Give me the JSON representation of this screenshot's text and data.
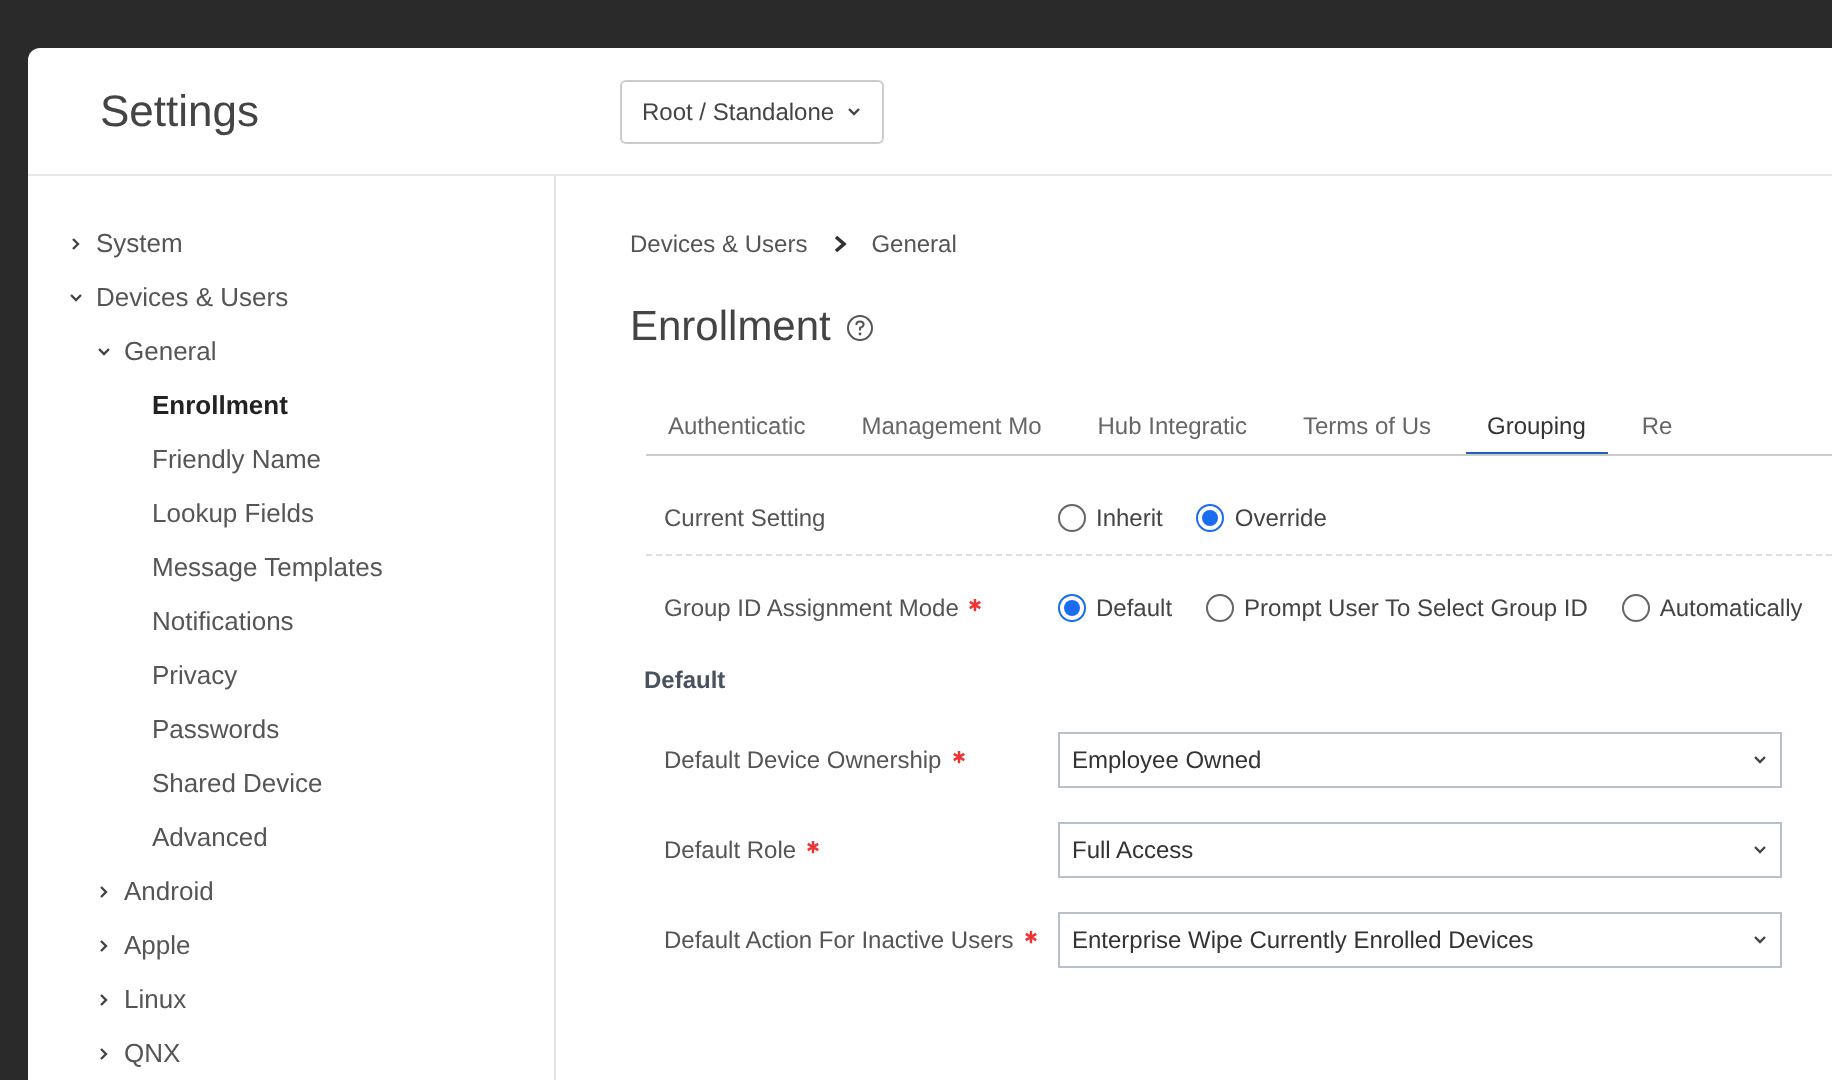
{
  "header": {
    "title": "Settings",
    "scope_button": "Root / Standalone"
  },
  "sidebar": {
    "items": [
      {
        "label": "System",
        "expanded": false,
        "selected": false
      },
      {
        "label": "Devices & Users",
        "expanded": true,
        "selected": false,
        "children": [
          {
            "label": "General",
            "expanded": true,
            "selected": false,
            "children": [
              {
                "label": "Enrollment",
                "selected": true
              },
              {
                "label": "Friendly Name",
                "selected": false
              },
              {
                "label": "Lookup Fields",
                "selected": false
              },
              {
                "label": "Message Templates",
                "selected": false
              },
              {
                "label": "Notifications",
                "selected": false
              },
              {
                "label": "Privacy",
                "selected": false
              },
              {
                "label": "Passwords",
                "selected": false
              },
              {
                "label": "Shared Device",
                "selected": false
              },
              {
                "label": "Advanced",
                "selected": false
              }
            ]
          },
          {
            "label": "Android",
            "expanded": false,
            "selected": false
          },
          {
            "label": "Apple",
            "expanded": false,
            "selected": false
          },
          {
            "label": "Linux",
            "expanded": false,
            "selected": false
          },
          {
            "label": "QNX",
            "expanded": false,
            "selected": false
          }
        ]
      }
    ]
  },
  "breadcrumb": [
    "Devices & Users",
    "General"
  ],
  "page_title": "Enrollment",
  "tabs": [
    {
      "label": "Authenticatic",
      "selected": false
    },
    {
      "label": "Management Mo",
      "selected": false
    },
    {
      "label": "Hub Integratic",
      "selected": false
    },
    {
      "label": "Terms of Us",
      "selected": false
    },
    {
      "label": "Grouping",
      "selected": true
    },
    {
      "label": "Re",
      "selected": false
    }
  ],
  "radio_rows": [
    {
      "label": "Current Setting",
      "required": false,
      "options": [
        {
          "label": "Inherit",
          "selected": false
        },
        {
          "label": "Override",
          "selected": true
        }
      ]
    },
    {
      "label": "Group ID Assignment Mode",
      "required": true,
      "options": [
        {
          "label": "Default",
          "selected": true
        },
        {
          "label": "Prompt User To Select Group ID",
          "selected": false
        },
        {
          "label": "Automatically",
          "selected": false
        }
      ]
    }
  ],
  "section_title": "Default",
  "select_rows": [
    {
      "label": "Default Device Ownership",
      "required": true,
      "value": "Employee Owned"
    },
    {
      "label": "Default Role",
      "required": true,
      "value": "Full Access"
    },
    {
      "label": "Default Action For Inactive Users",
      "required": true,
      "value": "Enterprise Wipe Currently Enrolled Devices"
    }
  ]
}
